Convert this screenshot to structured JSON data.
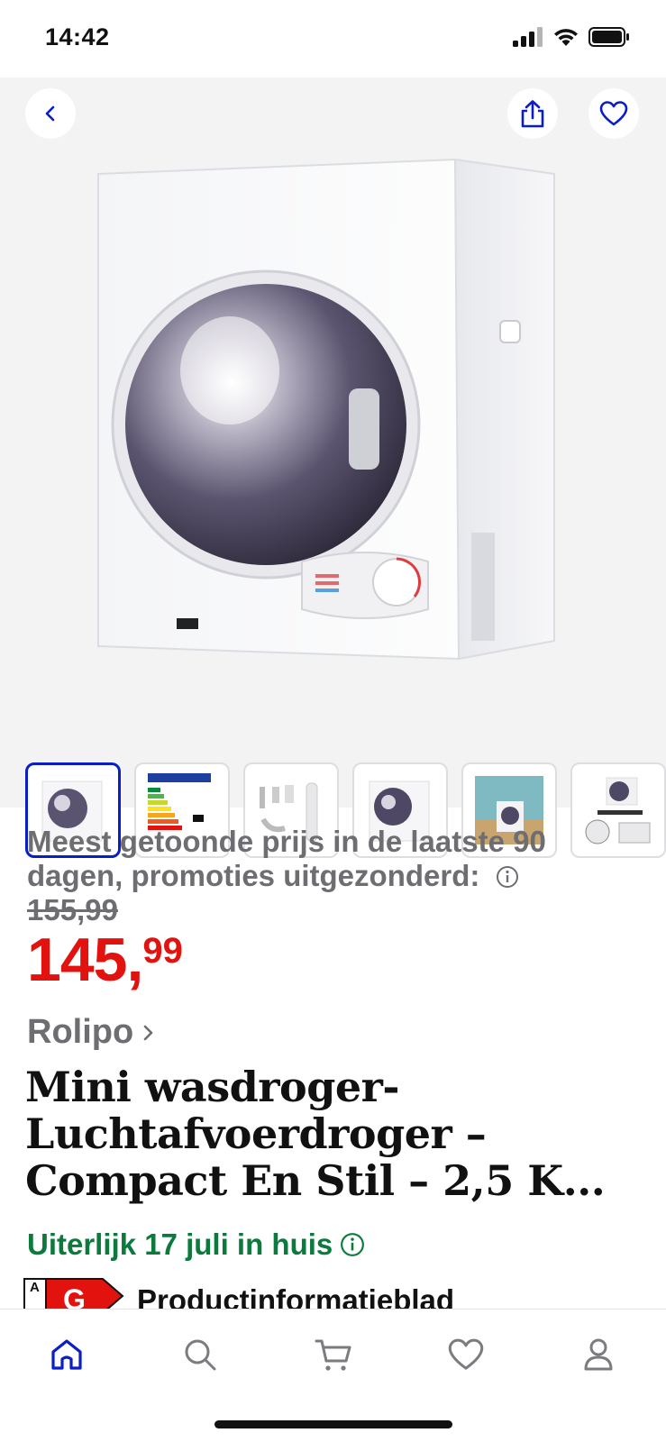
{
  "status_bar": {
    "time": "14:42"
  },
  "hero": {
    "icons": {
      "back": "chevron-left-icon",
      "share": "share-icon",
      "favorite": "heart-icon"
    },
    "thumbnail_count": 6,
    "selected_thumbnail": 1
  },
  "pricing": {
    "lowest_price_label": "Meest getoonde prijs in de laatste 90 dagen, promoties uitgezonderd:",
    "old_price": "155,99",
    "price_integer": "145,",
    "price_decimals": "99"
  },
  "product": {
    "brand": "Rolipo",
    "title": "Mini wasdroger- Luchtafvoerdroger – Compact En Stil – 2,5 K...",
    "delivery": "Uiterlijk 17 juli in huis",
    "energy_class": "G",
    "energy_scale_top": "A",
    "product_info_link": "Productinformatieblad"
  },
  "tab_bar": {
    "tabs": [
      "home-icon",
      "search-icon",
      "cart-icon",
      "heart-icon",
      "account-icon"
    ],
    "active": "home-icon"
  },
  "colors": {
    "accent": "#0a1ec8",
    "price": "#e2130f",
    "delivery": "#0b7a3c",
    "muted": "#6e6e72"
  }
}
